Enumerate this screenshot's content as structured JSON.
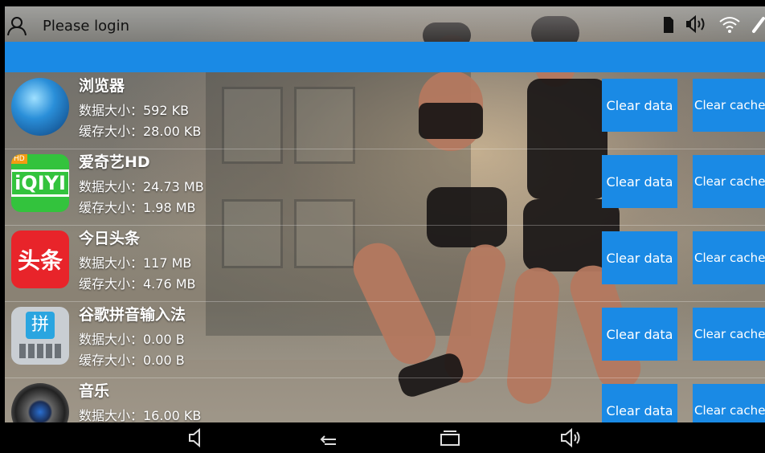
{
  "status": {
    "title": "Please login",
    "user_icon": "user-outline-icon",
    "icons": [
      "sim-icon",
      "volume-icon",
      "wifi-icon",
      "link-icon"
    ]
  },
  "apps": [
    {
      "name": "浏览器",
      "data_size": "数据大小：592 KB",
      "cache_size": "缓存大小：28.00 KB",
      "icon": "globe-icon",
      "clear_data": "Clear data",
      "clear_cache": "Clear cache"
    },
    {
      "name": "爱奇艺HD",
      "data_size": "数据大小：24.73 MB",
      "cache_size": "缓存大小：1.98 MB",
      "icon": "iqiyi-icon",
      "icon_text": "iQIYI",
      "badge": "HD",
      "clear_data": "Clear data",
      "clear_cache": "Clear cache"
    },
    {
      "name": "今日头条",
      "data_size": "数据大小：117 MB",
      "cache_size": "缓存大小：4.76 MB",
      "icon": "toutiao-icon",
      "icon_text": "头条",
      "clear_data": "Clear data",
      "clear_cache": "Clear cache"
    },
    {
      "name": "谷歌拼音输入法",
      "data_size": "数据大小：0.00 B",
      "cache_size": "缓存大小：0.00 B",
      "icon": "pinyin-keyboard-icon",
      "icon_text": "拼",
      "clear_data": "Clear data",
      "clear_cache": "Clear cache"
    },
    {
      "name": "音乐",
      "data_size": "数据大小：16.00 KB",
      "cache_size": "",
      "icon": "speaker-icon",
      "clear_data": "Clear data",
      "clear_cache": "Clear cache"
    }
  ],
  "navbar": {
    "icons": [
      "volume-down-icon",
      "back-icon",
      "recents-icon",
      "volume-up-icon"
    ]
  },
  "colors": {
    "accent": "#1a8ae5",
    "navbar": "#000000",
    "text_light": "#ffffff"
  }
}
